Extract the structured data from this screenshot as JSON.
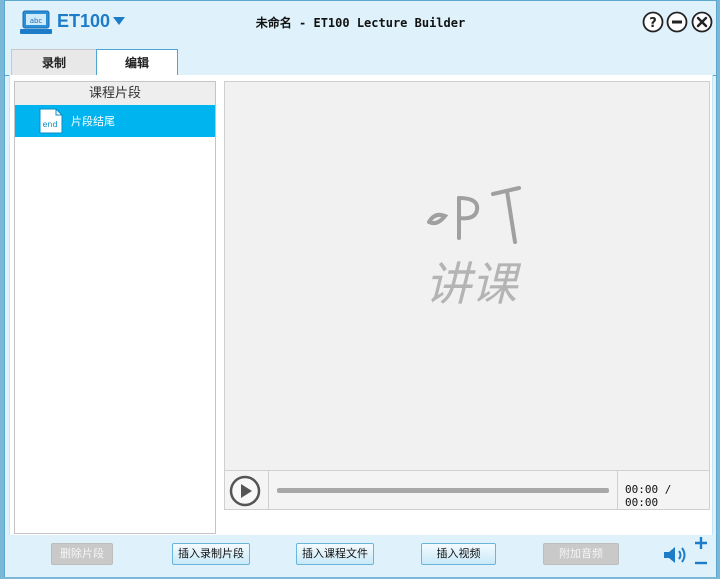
{
  "titlebar": {
    "app_name": "ET100",
    "window_title": "未命名 - ET100 Lecture Builder",
    "logo_text": "abc"
  },
  "tabs": [
    {
      "label": "录制",
      "active": false
    },
    {
      "label": "编辑",
      "active": true
    }
  ],
  "segments": {
    "header": "课程片段",
    "items": [
      {
        "icon_text": "end",
        "label": "片段结尾",
        "selected": true
      }
    ]
  },
  "preview": {
    "watermark_latin": "PPT",
    "watermark_cn": "讲课"
  },
  "player": {
    "time": "00:00 / 00:00",
    "progress": 0
  },
  "buttons": {
    "delete_segment": "删除片段",
    "insert_recording": "插入录制片段",
    "insert_course_file": "插入课程文件",
    "insert_video": "插入视频",
    "add_audio": "附加音频"
  },
  "icons": {
    "help": "help-icon",
    "minimize": "minimize-icon",
    "close": "close-icon",
    "volume": "volume-icon",
    "zoom_in": "plus-icon",
    "zoom_out": "minus-icon"
  },
  "colors": {
    "accent": "#1d7cc8",
    "selection": "#00b4ef",
    "tab_border": "#4da5d2"
  }
}
